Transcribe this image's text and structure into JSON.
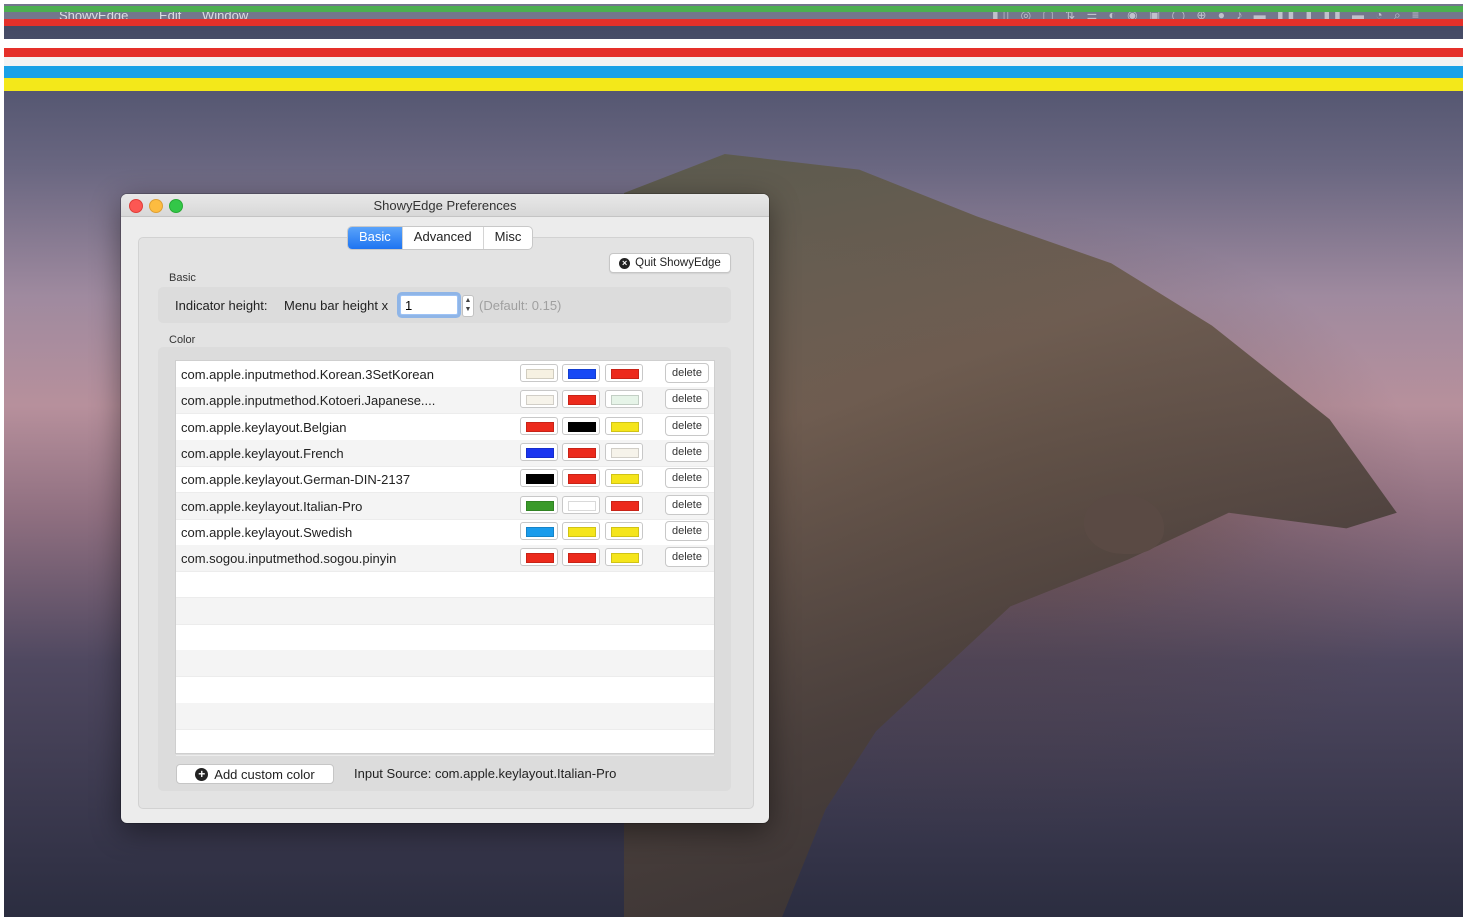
{
  "menubar": {
    "apple": "",
    "app_name": "ShowyEdge",
    "menu_edit": "Edit",
    "menu_window": "Window",
    "status_icons": "▮▯ ◎ ▢ ⇅ ☰ ◐ ◉ ▣ ◯ ⊕ ● ♪ ▬ ▮▮ ▮ ▮▮ ▬ ◔ ⌕ ≡"
  },
  "indicator_stripes": [
    "#4caf50",
    "#e5302a",
    "#ffffff",
    "#e5302a",
    "#f3f3f3",
    "#1aa1e6",
    "#f3e81a"
  ],
  "window": {
    "title": "ShowyEdge Preferences",
    "tabs": [
      {
        "label": "Basic",
        "active": true
      },
      {
        "label": "Advanced",
        "active": false
      },
      {
        "label": "Misc",
        "active": false
      }
    ],
    "quit_button": "Quit ShowyEdge",
    "basic": {
      "section_label": "Basic",
      "indicator_label": "Indicator height:",
      "menu_bar_label": "Menu bar height x",
      "height_value": "1",
      "default_hint": "(Default: 0.15)"
    },
    "color": {
      "section_label": "Color",
      "delete_label": "delete",
      "rows": [
        {
          "name": "com.apple.inputmethod.Korean.3SetKorean",
          "colors": [
            "#f6f1e2",
            "#1749f5",
            "#ec2a1c"
          ]
        },
        {
          "name": "com.apple.inputmethod.Kotoeri.Japanese....",
          "colors": [
            "#f6f3ea",
            "#ec2a1c",
            "#e6f4e8"
          ]
        },
        {
          "name": "com.apple.keylayout.Belgian",
          "colors": [
            "#ec2a1c",
            "#000000",
            "#f5e51b"
          ]
        },
        {
          "name": "com.apple.keylayout.French",
          "colors": [
            "#1a35f0",
            "#ec2a1c",
            "#f6f3ea"
          ]
        },
        {
          "name": "com.apple.keylayout.German-DIN-2137",
          "colors": [
            "#000000",
            "#ec2a1c",
            "#f5e51b"
          ]
        },
        {
          "name": "com.apple.keylayout.Italian-Pro",
          "colors": [
            "#3a9a2a",
            "#ffffff",
            "#ec2a1c"
          ]
        },
        {
          "name": "com.apple.keylayout.Swedish",
          "colors": [
            "#1a9cec",
            "#f5e51b",
            "#f5e51b"
          ]
        },
        {
          "name": "com.sogou.inputmethod.sogou.pinyin",
          "colors": [
            "#ec2a1c",
            "#ec2a1c",
            "#f5e51b"
          ]
        }
      ],
      "add_button": "Add custom color",
      "input_source": "Input Source:  com.apple.keylayout.Italian-Pro"
    }
  }
}
